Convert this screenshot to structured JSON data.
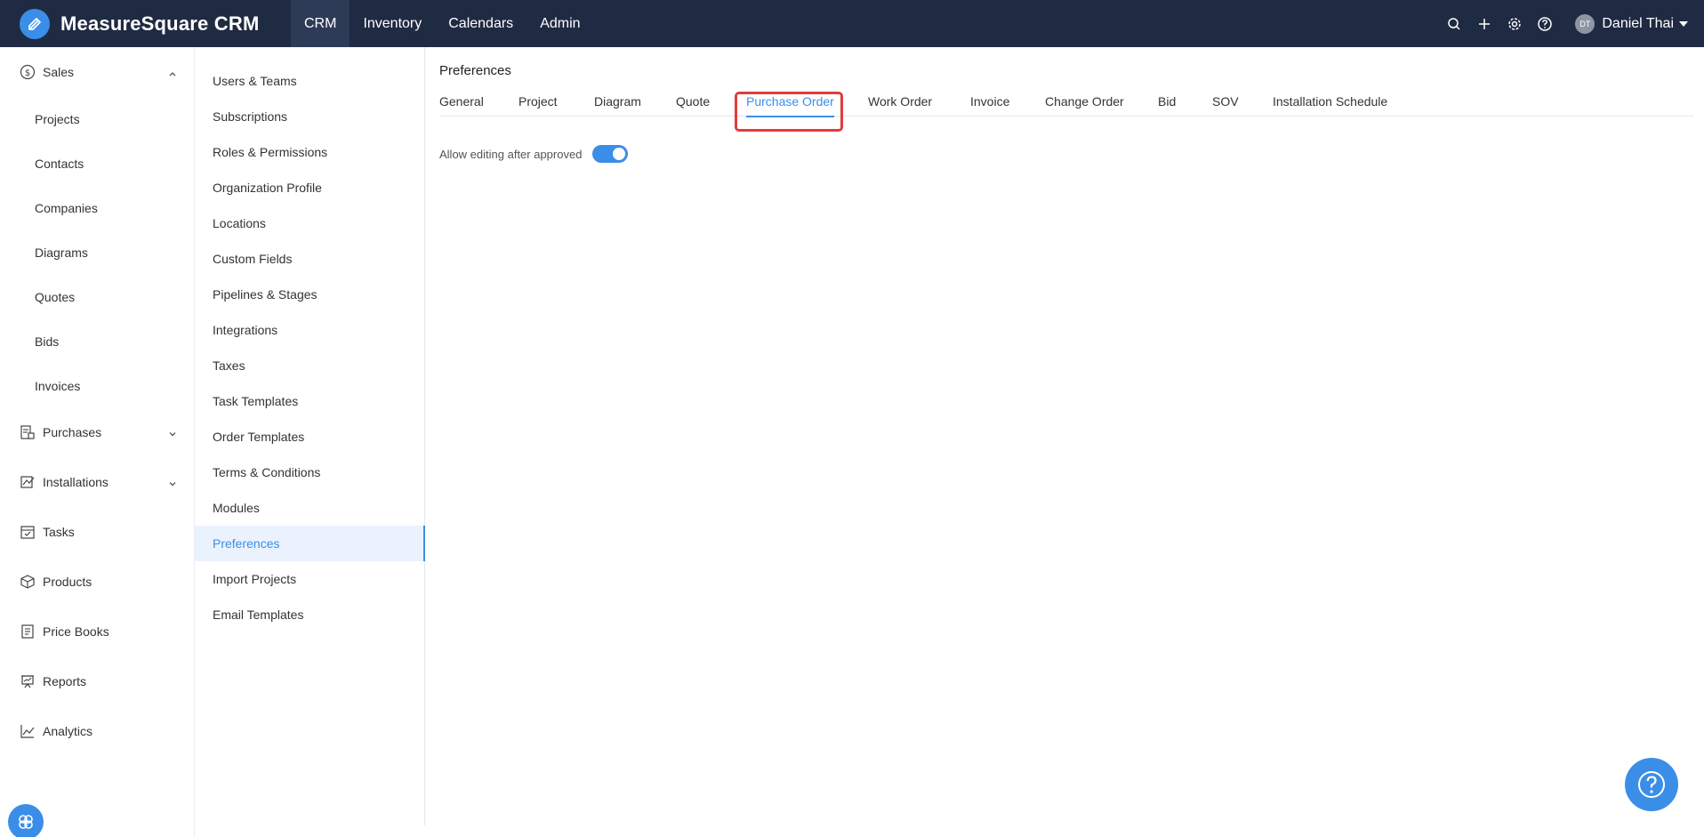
{
  "brand": {
    "name": "MeasureSquare CRM"
  },
  "topnav": [
    {
      "label": "CRM",
      "active": true
    },
    {
      "label": "Inventory",
      "active": false
    },
    {
      "label": "Calendars",
      "active": false
    },
    {
      "label": "Admin",
      "active": false
    }
  ],
  "user": {
    "initials": "DT",
    "name": "Daniel Thai"
  },
  "leftnav": {
    "sales": "Sales",
    "sales_items": [
      "Projects",
      "Contacts",
      "Companies",
      "Diagrams",
      "Quotes",
      "Bids",
      "Invoices"
    ],
    "purchases": "Purchases",
    "installations": "Installations",
    "tasks": "Tasks",
    "products": "Products",
    "price_books": "Price Books",
    "reports": "Reports",
    "analytics": "Analytics"
  },
  "submenu": [
    "Users & Teams",
    "Subscriptions",
    "Roles & Permissions",
    "Organization Profile",
    "Locations",
    "Custom Fields",
    "Pipelines & Stages",
    "Integrations",
    "Taxes",
    "Task Templates",
    "Order Templates",
    "Terms & Conditions",
    "Modules",
    "Preferences",
    "Import Projects",
    "Email Templates"
  ],
  "submenu_active": "Preferences",
  "content": {
    "title": "Preferences",
    "tabs": [
      "General",
      "Project",
      "Diagram",
      "Quote",
      "Purchase Order",
      "Work Order",
      "Invoice",
      "Change Order",
      "Bid",
      "SOV",
      "Installation Schedule"
    ],
    "active_tab": "Purchase Order",
    "setting_label": "Allow editing after approved",
    "setting_enabled": true
  },
  "colors": {
    "topbar": "#1f2b42",
    "accent": "#3b8ee8",
    "highlight": "#e23c3c"
  }
}
